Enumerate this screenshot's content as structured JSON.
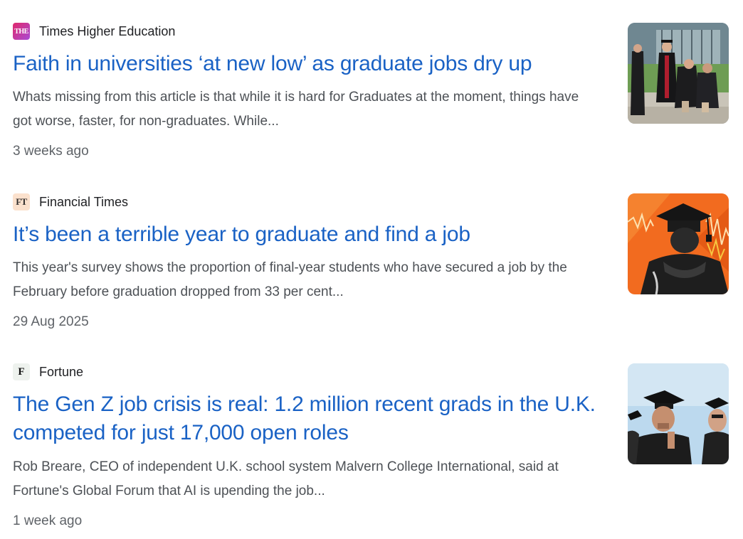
{
  "results": [
    {
      "source": "Times Higher Education",
      "favicon_text": "THE",
      "title": "Faith in universities ‘at new low’ as graduate jobs dry up",
      "snippet": "Whats missing from this article is that while it is hard for Graduates at the moment, things have got worse, faster, for non-graduates. While...",
      "date": "3 weeks ago"
    },
    {
      "source": "Financial Times",
      "favicon_text": "FT",
      "title": "It’s been a terrible year to graduate and find a job",
      "snippet": "This year's survey shows the proportion of final-year students who have secured a job by the February before graduation dropped from 33 per cent...",
      "date": "29 Aug 2025"
    },
    {
      "source": "Fortune",
      "favicon_text": "F",
      "title": "The Gen Z job crisis is real: 1.2 million recent grads in the U.K. competed for just 17,000 open roles",
      "snippet": "Rob Breare, CEO of independent U.K. school system Malvern College International, said at Fortune's Global Forum that AI is upending the job...",
      "date": "1 week ago"
    }
  ],
  "colors": {
    "title_link": "#1a62c5",
    "snippet_text": "#4d5156",
    "date_text": "#5f6368"
  }
}
